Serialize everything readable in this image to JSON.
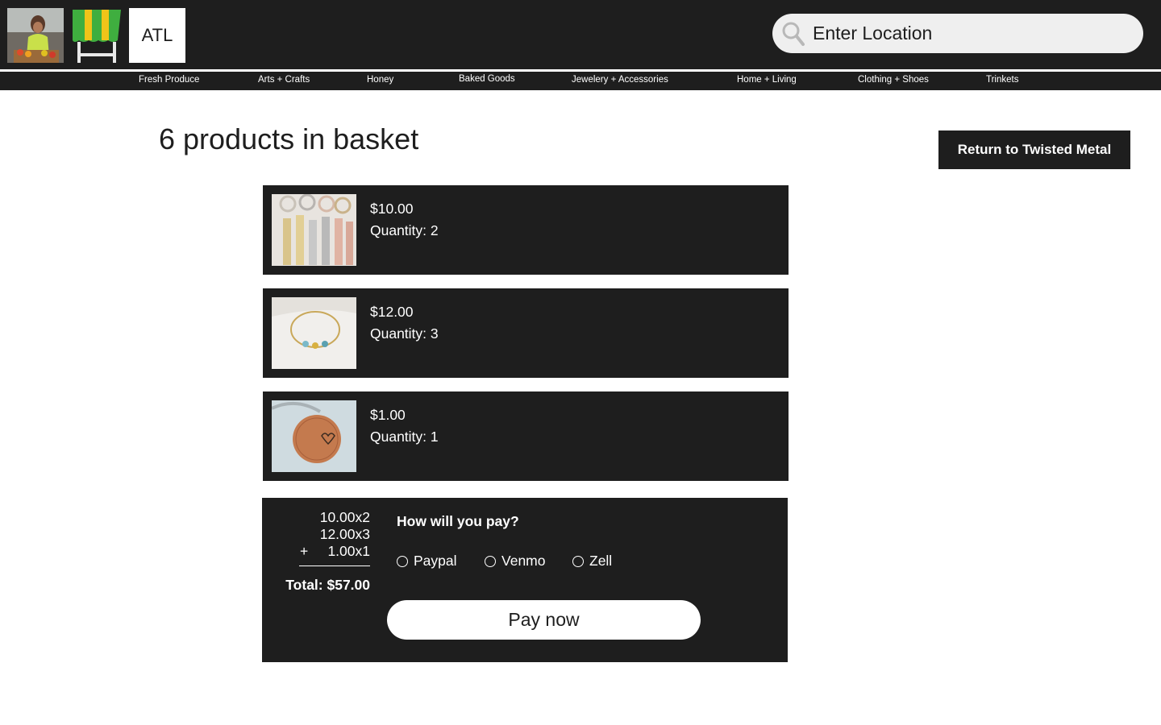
{
  "header": {
    "brand_short": "ATL",
    "search": {
      "placeholder": "Enter Location"
    },
    "colors": {
      "background": "#1e1e1e",
      "stand_green": "#3fae3f",
      "stand_yellow": "#f0c419"
    }
  },
  "nav": {
    "items": [
      {
        "label": "Fresh Produce"
      },
      {
        "label": "Arts + Crafts"
      },
      {
        "label": "Honey"
      },
      {
        "label": "Baked Goods"
      },
      {
        "label": "Jewelery + Accessories"
      },
      {
        "label": "Home + Living"
      },
      {
        "label": "Clothing + Shoes"
      },
      {
        "label": "Trinkets"
      }
    ]
  },
  "basket": {
    "title": "6 products in basket",
    "return_button": "Return to Twisted Metal",
    "items": [
      {
        "price": "$10.00",
        "quantity": "Quantity: 2",
        "image": "bar-keychains-photo"
      },
      {
        "price": "$12.00",
        "quantity": "Quantity: 3",
        "image": "charm-bracelet-photo"
      },
      {
        "price": "$1.00",
        "quantity": "Quantity: 1",
        "image": "penny-keychain-photo"
      }
    ]
  },
  "checkout": {
    "lines": [
      "10.00x2",
      "12.00x3",
      "1.00x1"
    ],
    "plus_sign": "+",
    "total": "Total: $57.00",
    "question": "How will you pay?",
    "options": [
      {
        "label": "Paypal",
        "selected": false
      },
      {
        "label": "Venmo",
        "selected": false
      },
      {
        "label": "Zell",
        "selected": false
      }
    ],
    "pay_button": "Pay now"
  }
}
